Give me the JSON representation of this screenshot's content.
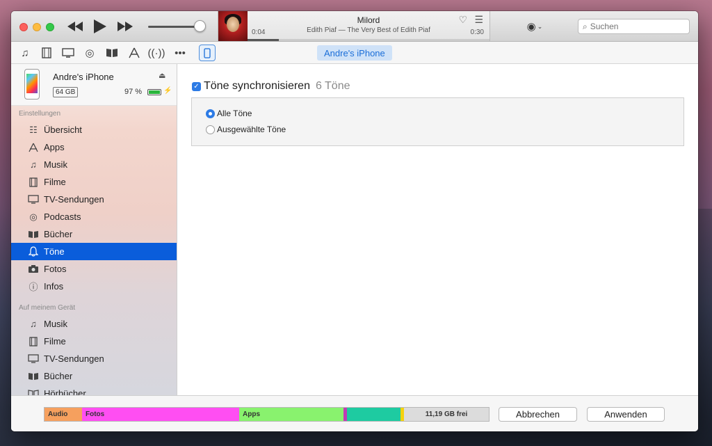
{
  "colors": {
    "accent": "#0a5ddb",
    "capacity": {
      "audio": "#f6a05e",
      "fotos": "#ff4ef2",
      "apps": "#89f26e",
      "purple": "#c13bb4",
      "teal": "#1ecba1",
      "yellow": "#f5d20e",
      "free": "#dcdcdc"
    }
  },
  "player": {
    "track_title": "Milord",
    "track_subtitle": "Edith Piaf — The Very Best of Edith Piaf",
    "elapsed": "0:04",
    "remaining": "0:30",
    "progress": 0.13,
    "volume": 0.88
  },
  "search": {
    "placeholder": "Suchen"
  },
  "toolbar": {
    "device_tab": "Andre's iPhone"
  },
  "device": {
    "name": "Andre's iPhone",
    "capacity": "64 GB",
    "battery": "97 %",
    "battery_level": 0.97
  },
  "sidebar": {
    "settings_header": "Einstellungen",
    "settings_items": [
      {
        "label": "Übersicht",
        "icon": "summary-icon"
      },
      {
        "label": "Apps",
        "icon": "apps-icon"
      },
      {
        "label": "Musik",
        "icon": "music-note-icon"
      },
      {
        "label": "Filme",
        "icon": "film-icon"
      },
      {
        "label": "TV-Sendungen",
        "icon": "tv-icon"
      },
      {
        "label": "Podcasts",
        "icon": "podcast-icon"
      },
      {
        "label": "Bücher",
        "icon": "book-icon"
      },
      {
        "label": "Töne",
        "icon": "bell-icon",
        "selected": true
      },
      {
        "label": "Fotos",
        "icon": "camera-icon"
      },
      {
        "label": "Infos",
        "icon": "info-icon"
      }
    ],
    "device_header": "Auf meinem Gerät",
    "device_items": [
      {
        "label": "Musik",
        "icon": "music-note-icon"
      },
      {
        "label": "Filme",
        "icon": "film-icon"
      },
      {
        "label": "TV-Sendungen",
        "icon": "tv-icon"
      },
      {
        "label": "Bücher",
        "icon": "book-icon"
      },
      {
        "label": "Hörbücher",
        "icon": "audiobook-icon"
      }
    ]
  },
  "content": {
    "sync_label": "Töne synchronisieren",
    "sync_count": "6 Töne",
    "sync_checked": true,
    "option_all": "Alle Töne",
    "option_selected": "Ausgewählte Töne",
    "selected_option": "all"
  },
  "capacity_bar": {
    "audio": "Audio",
    "fotos": "Fotos",
    "apps": "Apps",
    "free": "11,19 GB frei"
  },
  "buttons": {
    "cancel": "Abbrechen",
    "apply": "Anwenden"
  }
}
